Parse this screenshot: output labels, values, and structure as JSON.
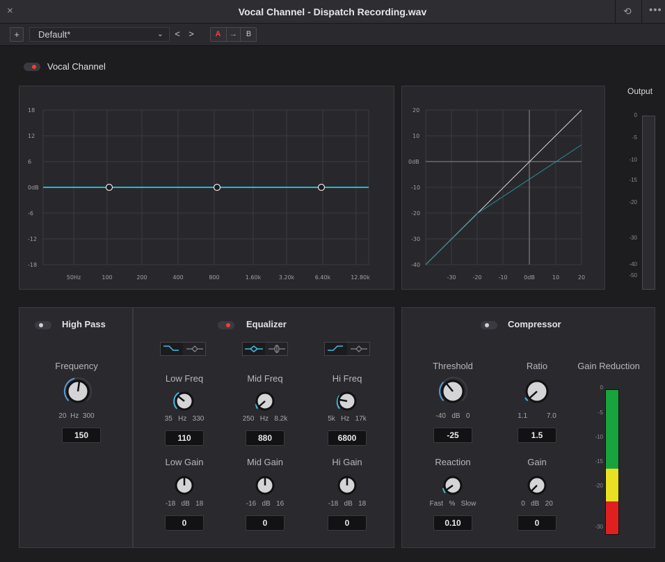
{
  "window": {
    "title": "Vocal Channel - Dispatch Recording.wav",
    "close_glyph": "×",
    "history_glyph": "⟲",
    "more_glyph": "•••"
  },
  "toolbar": {
    "add_label": "+",
    "preset_value": "Default*",
    "preset_chevron": "⌄",
    "prev_label": "<",
    "next_label": ">",
    "a_label": "A",
    "copy_label": "→",
    "b_label": "B"
  },
  "plugin": {
    "name": "Vocal Channel",
    "enabled": true
  },
  "eq_graph": {
    "y_ticks": [
      "18",
      "12",
      "6",
      "0dB",
      "-6",
      "-12",
      "-18"
    ],
    "x_ticks": [
      "50Hz",
      "100",
      "200",
      "400",
      "800",
      "1.60k",
      "3.20k",
      "6.40k",
      "12.80k"
    ],
    "band_frequencies": [
      "100",
      "800",
      "6.40k"
    ]
  },
  "comp_graph": {
    "y_ticks": [
      "20",
      "10",
      "0dB",
      "-10",
      "-20",
      "-30",
      "-40"
    ],
    "x_ticks": [
      "-30",
      "-20",
      "-10",
      "0dB",
      "10",
      "20"
    ]
  },
  "output_meter": {
    "title": "Output",
    "ticks": [
      "0",
      "-5",
      "-10",
      "-15",
      "-20",
      "-30",
      "-40",
      "-50"
    ]
  },
  "high_pass": {
    "title": "High Pass",
    "enabled": false,
    "frequency_label": "Frequency",
    "range": "20  Hz  300",
    "value": "150"
  },
  "equalizer": {
    "title": "Equalizer",
    "enabled": true,
    "low_freq": {
      "label": "Low Freq",
      "range": "35   Hz   330",
      "value": "110"
    },
    "mid_freq": {
      "label": "Mid Freq",
      "range": "250   Hz   8.2k",
      "value": "880"
    },
    "hi_freq": {
      "label": "Hi Freq",
      "range": "5k   Hz   17k",
      "value": "6800"
    },
    "low_gain": {
      "label": "Low Gain",
      "range": "-18   dB   18",
      "value": "0"
    },
    "mid_gain": {
      "label": "Mid Gain",
      "range": "-16   dB   16",
      "value": "0"
    },
    "hi_gain": {
      "label": "Hi Gain",
      "range": "-18   dB   18",
      "value": "0"
    }
  },
  "compressor": {
    "title": "Compressor",
    "enabled": false,
    "threshold": {
      "label": "Threshold",
      "range": "-40   dB   0",
      "value": "-25"
    },
    "ratio": {
      "label": "Ratio",
      "range": "1.1          7.0",
      "value": "1.5"
    },
    "reaction": {
      "label": "Reaction",
      "range": "Fast   %   Slow",
      "value": "0.10"
    },
    "gain": {
      "label": "Gain",
      "range": "0   dB   20",
      "value": "0"
    },
    "gain_reduction": {
      "label": "Gain Reduction",
      "ticks": [
        "0",
        "-5",
        "-10",
        "-15",
        "-20",
        "-30"
      ]
    }
  },
  "colors": {
    "eq_curve": "#22b8d8",
    "accent_red": "#ff3b30",
    "meter_green": "#18a33c",
    "meter_yellow": "#e8e022",
    "meter_red": "#e02020"
  }
}
